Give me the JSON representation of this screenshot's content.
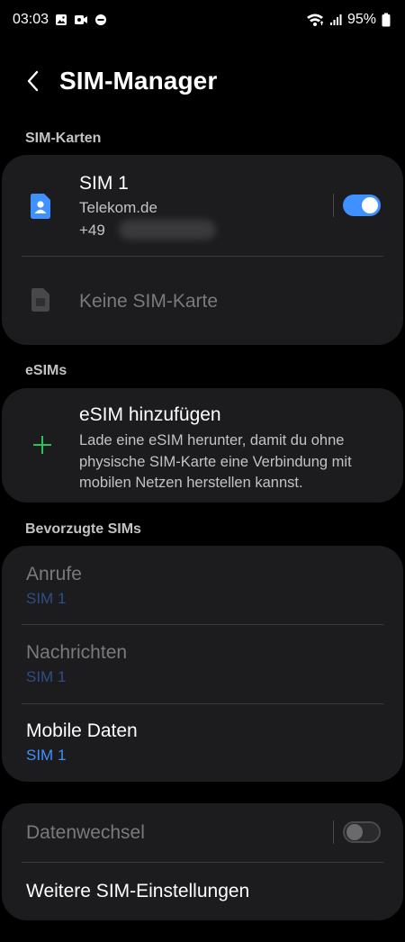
{
  "status": {
    "time": "03:03",
    "battery": "95%"
  },
  "header": {
    "title": "SIM-Manager"
  },
  "sections": {
    "sim_cards": "SIM-Karten",
    "esims": "eSIMs",
    "preferred": "Bevorzugte SIMs"
  },
  "sim1": {
    "name": "SIM 1",
    "carrier": "Telekom.de",
    "number_prefix": "+49",
    "enabled": true
  },
  "sim2": {
    "label": "Keine SIM-Karte"
  },
  "esim": {
    "title": "eSIM hinzufügen",
    "description": "Lade eine eSIM herunter, damit du ohne physische SIM-Karte eine Verbindung mit mobilen Netzen herstellen kannst."
  },
  "preferred": {
    "calls_label": "Anrufe",
    "calls_value": "SIM 1",
    "messages_label": "Nachrichten",
    "messages_value": "SIM 1",
    "data_label": "Mobile Daten",
    "data_value": "SIM 1"
  },
  "more": {
    "data_switch_label": "Datenwechsel",
    "data_switch_enabled": false,
    "more_settings_label": "Weitere SIM-Einstellungen"
  },
  "colors": {
    "accent": "#3e91ff",
    "dim_accent": "#2d4f86",
    "card_bg": "#1c1c1e",
    "plus_green": "#2fbf5b"
  },
  "icons": {
    "back": "chevron-left-icon",
    "sim1": "sim-card-person-icon",
    "sim2": "sim-card-icon",
    "esim_add": "plus-icon"
  }
}
